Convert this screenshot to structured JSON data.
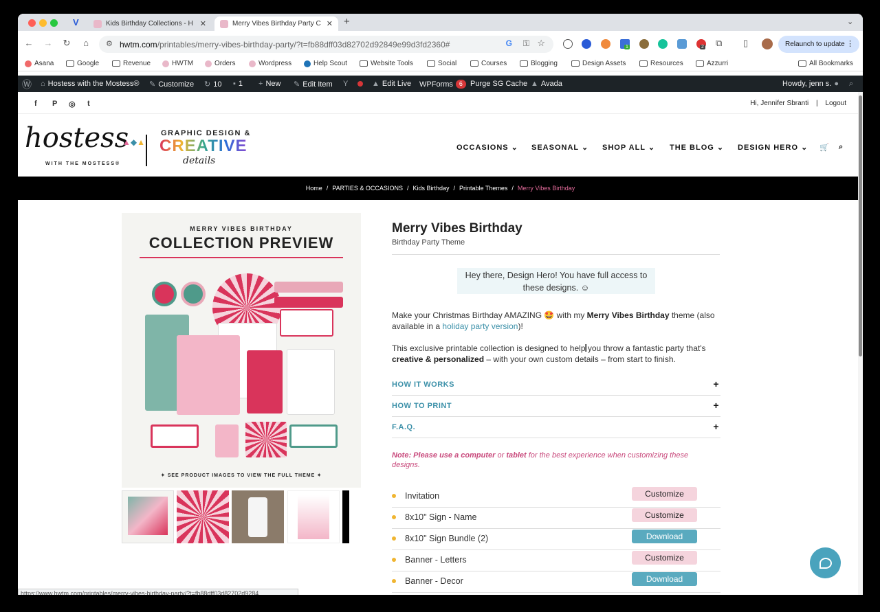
{
  "browser": {
    "tabs": [
      {
        "title": "Kids Birthday Collections - H",
        "active": false
      },
      {
        "title": "Merry Vibes Birthday Party C",
        "active": true
      }
    ],
    "new_tab": "+",
    "url_host": "hwtm.com",
    "url_path": "/printables/merry-vibes-birthday-party/?t=fb88dff03d82702d92849e99d3fd2360#",
    "relaunch_label": "Relaunch to update",
    "ext_badges": [
      "1",
      "2"
    ]
  },
  "bookmarks": {
    "items": [
      "Asana",
      "Google",
      "Revenue",
      "HWTM",
      "Orders",
      "Wordpress",
      "Help Scout",
      "Website Tools",
      "Social",
      "Courses",
      "Blogging",
      "Design Assets",
      "Resources",
      "Azzurri"
    ],
    "all": "All Bookmarks"
  },
  "adminbar": {
    "site": "Hostess with the Mostess®",
    "customize": "Customize",
    "updates": "10",
    "comments": "1",
    "new": "New",
    "edit_item": "Edit Item",
    "edit_live": "Edit Live",
    "wpforms": "WPForms",
    "wpforms_count": "6",
    "purge": "Purge SG Cache",
    "avada": "Avada",
    "howdy": "Howdy, jenn s."
  },
  "site": {
    "social": [
      "f",
      "P",
      "◎",
      "t"
    ],
    "user_greeting": "Hi, Jennifer Sbranti",
    "separator": "|",
    "logout": "Logout",
    "logo_main": "hostess",
    "logo_main_sub": "WITH THE MOSTESS®",
    "logo_side_top": "GRAPHIC DESIGN &",
    "logo_side_big": "CREATIVE",
    "logo_side_script": "details",
    "menu": [
      "OCCASIONS",
      "SEASONAL",
      "SHOP ALL",
      "THE BLOG",
      "DESIGN HERO"
    ]
  },
  "breadcrumb": [
    "Home",
    "PARTIES & OCCASIONS",
    "Kids Birthday",
    "Printable Themes",
    "Merry Vibes Birthday"
  ],
  "product_image": {
    "kicker": "MERRY VIBES BIRTHDAY",
    "heading": "COLLECTION PREVIEW",
    "footer": "✦ SEE PRODUCT IMAGES TO VIEW THE FULL THEME ✦"
  },
  "product": {
    "title": "Merry Vibes Birthday",
    "subtitle": "Birthday Party Theme",
    "notice": "Hey there, Design Hero! You have full access to these designs. ☺",
    "para1_a": "Make your Christmas Birthday AMAZING 🤩 with my ",
    "para1_b": "Merry Vibes Birthday",
    "para1_c": " theme (also available in a ",
    "para1_link": "holiday party version",
    "para1_d": ")!",
    "para2_a": "This exclusive printable collection is designed to help you throw a fantastic party that's ",
    "para2_b": "creative & personalized",
    "para2_c": " – with your own custom details – from start to finish.",
    "accordions": [
      "HOW IT WORKS",
      "HOW TO PRINT",
      "F.A.Q."
    ],
    "note_a": "Note: ",
    "note_b": "Please use a computer",
    "note_c": " or ",
    "note_d": "tablet",
    "note_e": " for the best experience when customizing these designs.",
    "items": [
      {
        "label": "Invitation",
        "action": "Customize"
      },
      {
        "label": "8x10\" Sign - Name",
        "action": "Customize"
      },
      {
        "label": "8x10\" Sign Bundle (2)",
        "action": "Download"
      },
      {
        "label": "Banner - Letters",
        "action": "Customize"
      },
      {
        "label": "Banner - Decor",
        "action": "Download"
      }
    ]
  },
  "status_url": "https://www.hwtm.com/printables/merry-vibes-birthday-party/?t=fb88dff03d82702d9284",
  "colors": {
    "accent_teal": "#3a8fa8",
    "pink": "#c8487b",
    "customize_bg": "#f5d4dd",
    "download_bg": "#5aaabf",
    "adminbar": "#1d2327"
  }
}
